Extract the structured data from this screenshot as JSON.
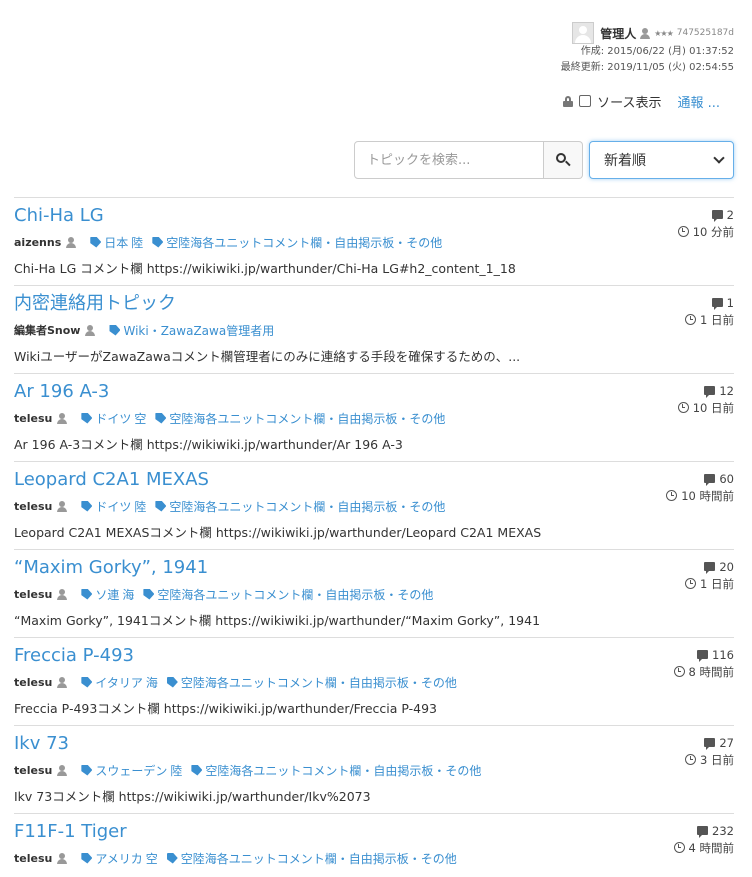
{
  "meta": {
    "author_name": "管理人",
    "stars": "★★★",
    "author_id": "747525187d",
    "created": "作成: 2015/06/22 (月) 01:37:52",
    "updated": "最終更新: 2019/11/05 (火) 02:54:55"
  },
  "source": {
    "label": "ソース表示",
    "report_label": "通報 ..."
  },
  "search": {
    "placeholder": "トピックを検索...",
    "sort_selected": "新着順"
  },
  "colors": {
    "link": "#3a8fd0",
    "text": "#333333",
    "border": "#dddddd",
    "focus": "#66afe9"
  },
  "topics": [
    {
      "title": "Chi-Ha LG",
      "author": "aizenns",
      "tags": [
        [
          "日本",
          "陸"
        ],
        [
          "空陸海各ユニットコメント欄・自由掲示板・その他"
        ]
      ],
      "excerpt": "Chi-Ha LG コメント欄 https://wikiwiki.jp/warthunder/Chi-Ha LG#h2_content_1_18",
      "comments": "2",
      "time": "10 分前"
    },
    {
      "title": "内密連絡用トピック",
      "author": "編集者Snow",
      "tags": [
        [
          "Wiki・ZawaZawa管理者用"
        ]
      ],
      "excerpt": "WikiユーザーがZawaZawaコメント欄管理者にのみに連絡する手段を確保するための、...",
      "comments": "1",
      "time": "1 日前"
    },
    {
      "title": "Ar 196 A-3",
      "author": "telesu",
      "tags": [
        [
          "ドイツ",
          "空"
        ],
        [
          "空陸海各ユニットコメント欄・自由掲示板・その他"
        ]
      ],
      "excerpt": "Ar 196 A-3コメント欄 https://wikiwiki.jp/warthunder/Ar 196 A-3",
      "comments": "12",
      "time": "10 日前"
    },
    {
      "title": "Leopard C2A1 MEXAS",
      "author": "telesu",
      "tags": [
        [
          "ドイツ",
          "陸"
        ],
        [
          "空陸海各ユニットコメント欄・自由掲示板・その他"
        ]
      ],
      "excerpt": "Leopard C2A1 MEXASコメント欄 https://wikiwiki.jp/warthunder/Leopard C2A1 MEXAS",
      "comments": "60",
      "time": "10 時間前"
    },
    {
      "title": "“Maxim Gorky”, 1941",
      "author": "telesu",
      "tags": [
        [
          "ソ連",
          "海"
        ],
        [
          "空陸海各ユニットコメント欄・自由掲示板・その他"
        ]
      ],
      "excerpt": "“Maxim Gorky”, 1941コメント欄 https://wikiwiki.jp/warthunder/“Maxim Gorky”, 1941",
      "comments": "20",
      "time": "1 日前"
    },
    {
      "title": "Freccia P-493",
      "author": "telesu",
      "tags": [
        [
          "イタリア",
          "海"
        ],
        [
          "空陸海各ユニットコメント欄・自由掲示板・その他"
        ]
      ],
      "excerpt": "Freccia P-493コメント欄 https://wikiwiki.jp/warthunder/Freccia P-493",
      "comments": "116",
      "time": "8 時間前"
    },
    {
      "title": "Ikv 73",
      "author": "telesu",
      "tags": [
        [
          "スウェーデン",
          "陸"
        ],
        [
          "空陸海各ユニットコメント欄・自由掲示板・その他"
        ]
      ],
      "excerpt": "Ikv 73コメント欄 https://wikiwiki.jp/warthunder/Ikv%2073",
      "comments": "27",
      "time": "3 日前"
    },
    {
      "title": "F11F-1 Tiger",
      "author": "telesu",
      "tags": [
        [
          "アメリカ",
          "空"
        ],
        [
          "空陸海各ユニットコメント欄・自由掲示板・その他"
        ]
      ],
      "excerpt": "",
      "comments": "232",
      "time": "4 時間前"
    }
  ]
}
